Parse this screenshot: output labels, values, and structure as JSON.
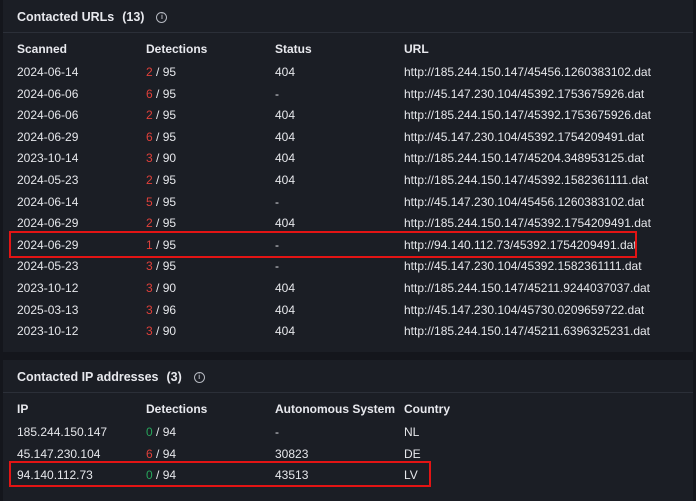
{
  "urls_section": {
    "title": "Contacted URLs",
    "count": "(13)",
    "columns": [
      "Scanned",
      "Detections",
      "Status",
      "URL"
    ],
    "rows": [
      {
        "scanned": "2024-06-14",
        "det": "2",
        "total": "/ 95",
        "status": "404",
        "url": "http://185.244.150.147/45456.1260383102.dat"
      },
      {
        "scanned": "2024-06-06",
        "det": "6",
        "total": "/ 95",
        "status": "-",
        "url": "http://45.147.230.104/45392.1753675926.dat"
      },
      {
        "scanned": "2024-06-06",
        "det": "2",
        "total": "/ 95",
        "status": "404",
        "url": "http://185.244.150.147/45392.1753675926.dat"
      },
      {
        "scanned": "2024-06-29",
        "det": "6",
        "total": "/ 95",
        "status": "404",
        "url": "http://45.147.230.104/45392.1754209491.dat"
      },
      {
        "scanned": "2023-10-14",
        "det": "3",
        "total": "/ 90",
        "status": "404",
        "url": "http://185.244.150.147/45204.348953125.dat"
      },
      {
        "scanned": "2024-05-23",
        "det": "2",
        "total": "/ 95",
        "status": "404",
        "url": "http://185.244.150.147/45392.1582361111.dat"
      },
      {
        "scanned": "2024-06-14",
        "det": "5",
        "total": "/ 95",
        "status": "-",
        "url": "http://45.147.230.104/45456.1260383102.dat"
      },
      {
        "scanned": "2024-06-29",
        "det": "2",
        "total": "/ 95",
        "status": "404",
        "url": "http://185.244.150.147/45392.1754209491.dat"
      },
      {
        "scanned": "2024-06-29",
        "det": "1",
        "total": "/ 95",
        "status": "-",
        "url": "http://94.140.112.73/45392.1754209491.dat"
      },
      {
        "scanned": "2024-05-23",
        "det": "3",
        "total": "/ 95",
        "status": "-",
        "url": "http://45.147.230.104/45392.1582361111.dat"
      },
      {
        "scanned": "2023-10-12",
        "det": "3",
        "total": "/ 90",
        "status": "404",
        "url": "http://185.244.150.147/45211.9244037037.dat"
      },
      {
        "scanned": "2025-03-13",
        "det": "3",
        "total": "/ 96",
        "status": "404",
        "url": "http://45.147.230.104/45730.0209659722.dat"
      },
      {
        "scanned": "2023-10-12",
        "det": "3",
        "total": "/ 90",
        "status": "404",
        "url": "http://185.244.150.147/45211.6396325231.dat"
      }
    ]
  },
  "ips_section": {
    "title": "Contacted IP addresses",
    "count": "(3)",
    "columns": [
      "IP",
      "Detections",
      "Autonomous System",
      "Country"
    ],
    "rows": [
      {
        "ip": "185.244.150.147",
        "det": "0",
        "total": "/ 94",
        "asn": "-",
        "country": "NL"
      },
      {
        "ip": "45.147.230.104",
        "det": "6",
        "total": "/ 94",
        "asn": "30823",
        "country": "DE"
      },
      {
        "ip": "94.140.112.73",
        "det": "0",
        "total": "/ 94",
        "asn": "43513",
        "country": "LV"
      }
    ]
  },
  "colors": {
    "background": "#14161c",
    "panel": "#1b1e25",
    "detection_positive": "#e0403a",
    "detection_zero": "#27a55b",
    "highlight_box": "#e31414"
  },
  "icons": {
    "info": "info-circle-icon"
  }
}
